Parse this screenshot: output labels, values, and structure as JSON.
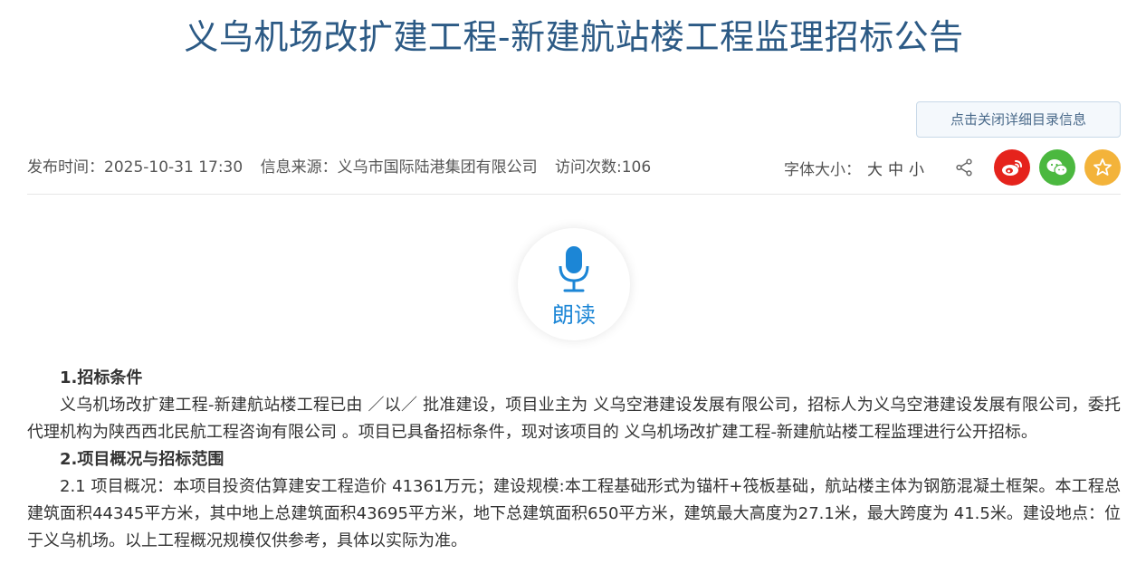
{
  "title": "义乌机场改扩建工程-新建航站楼工程监理招标公告",
  "toc_button": "点击关闭详细目录信息",
  "meta": {
    "publish_time": "发布时间：2025-10-31 17:30",
    "source": "信息来源：义乌市国际陆港集团有限公司",
    "visits": "访问次数:106",
    "font_size_label": "字体大小：",
    "font_large": "大",
    "font_medium": "中",
    "font_small": "小"
  },
  "read_aloud": {
    "label": "朗读"
  },
  "content": {
    "section1_title": "1.招标条件",
    "section1_para": "义乌机场改扩建工程-新建航站楼工程已由 ／以／ 批准建设，项目业主为 义乌空港建设发展有限公司，招标人为义乌空港建设发展有限公司，委托代理机构为陕西西北民航工程咨询有限公司 。项目已具备招标条件，现对该项目的 义乌机场改扩建工程-新建航站楼工程监理进行公开招标。",
    "section2_title": "2.项目概况与招标范围",
    "section2_para": "2.1 项目概况：本项目投资估算建安工程造价 41361万元；建设规模:本工程基础形式为锚杆+筏板基础，航站楼主体为钢筋混凝土框架。本工程总建筑面积44345平方米，其中地上总建筑面积43695平方米，地下总建筑面积650平方米，建筑最大高度为27.1米，最大跨度为 41.5米。建设地点：位于义乌机场。以上工程概况规模仅供参考，具体以实际为准。"
  },
  "colors": {
    "title": "#2c5a85",
    "weibo": "#e5231c",
    "wechat": "#4bb83f",
    "favorite": "#f3b33a",
    "read_accent": "#1c86d6"
  }
}
